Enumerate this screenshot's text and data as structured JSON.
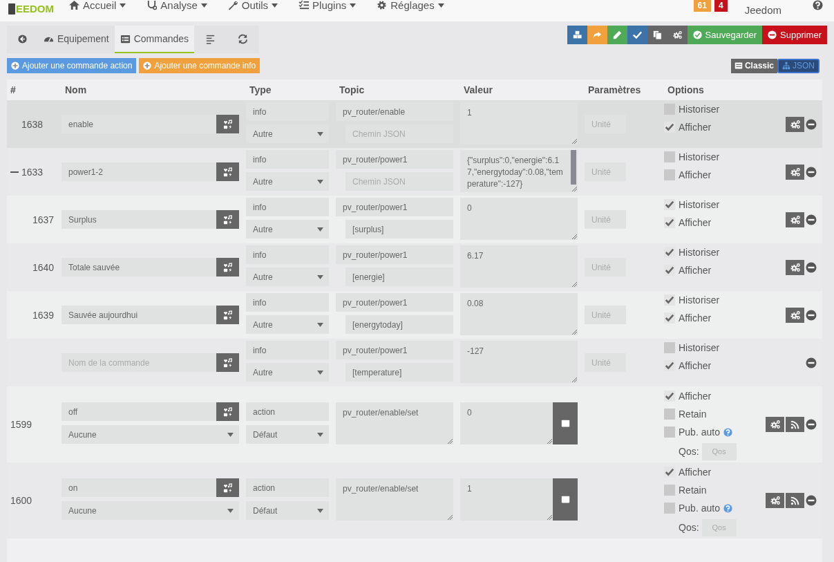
{
  "navbar": {
    "logo": "EEDOM",
    "menus": [
      {
        "kind": "home",
        "label": "Accueil"
      },
      {
        "kind": "analysis",
        "label": "Analyse"
      },
      {
        "kind": "tools",
        "label": "Outils"
      },
      {
        "kind": "plugins",
        "label": "Plugins"
      },
      {
        "kind": "settings",
        "label": "Réglages"
      }
    ],
    "badges": [
      {
        "text": "61",
        "color": "#f0a03c"
      },
      {
        "text": "4",
        "color": "#c8101a"
      }
    ],
    "user": "Jeedom"
  },
  "tabs": [
    {
      "kind": "back",
      "selected": false
    },
    {
      "kind": "equipment",
      "label": "Equipement",
      "selected": false
    },
    {
      "kind": "commands",
      "label": "Commandes",
      "selected": true
    },
    {
      "kind": "list",
      "selected": false
    },
    {
      "kind": "refresh",
      "selected": false
    }
  ],
  "toolbar": [
    {
      "kind": "cubes",
      "color": "#3c73a8"
    },
    {
      "kind": "share",
      "color": "#f0a03c"
    },
    {
      "kind": "pencil",
      "color": "#4faa58"
    },
    {
      "kind": "check",
      "color": "#3c73a8"
    },
    {
      "kind": "copy",
      "color": "#666666"
    },
    {
      "kind": "gears",
      "color": "#666666"
    },
    {
      "kind": "save",
      "label": "Sauvegarder",
      "color": "#4faa58"
    },
    {
      "kind": "delete",
      "label": "Supprimer",
      "color": "#c8101a"
    }
  ],
  "add_buttons": [
    {
      "label": "Ajouter une commande action",
      "color": "#5b9ae0"
    },
    {
      "label": "Ajouter une commande info",
      "color": "#f0a03c"
    }
  ],
  "view_toggle": [
    {
      "kind": "classic",
      "label": "Classic",
      "selected": false
    },
    {
      "kind": "json",
      "label": "JSON",
      "selected": true
    }
  ],
  "table": {
    "columns": [
      "#",
      "Nom",
      "Type",
      "Topic",
      "Valeur",
      "Paramètres",
      "Options"
    ],
    "rows": [
      {
        "kind": "info",
        "id": "1638",
        "highlighted": true,
        "name": "enable",
        "type": "info",
        "subtype": "Autre",
        "topic": "pv_router/enable",
        "json_path_placeholder": "Chemin JSON",
        "value": "1",
        "unit_placeholder": "Unité",
        "options": [
          {
            "label": "Historiser",
            "checked": false
          },
          {
            "label": "Afficher",
            "checked": true
          }
        ],
        "config_button": true
      },
      {
        "kind": "info",
        "id": "1633",
        "highlighted": false,
        "expanded": true,
        "name": "power1-2",
        "type": "info",
        "subtype": "Autre",
        "topic": "pv_router/power1",
        "json_path_placeholder": "Chemin JSON",
        "value": "{\"surplus\":0,\"energie\":6.17,\"energytoday\":0.08,\"temperature\":-127}",
        "unit_placeholder": "Unité",
        "options": [
          {
            "label": "Historiser",
            "checked": false
          },
          {
            "label": "Afficher",
            "checked": false
          }
        ],
        "config_button": true,
        "children": [
          {
            "kind": "info",
            "id": "1637",
            "highlighted": false,
            "name": "Surplus",
            "type": "info",
            "subtype": "Autre",
            "topic": "pv_router/power1",
            "json_path": "[surplus]",
            "value": "0",
            "unit_placeholder": "Unité",
            "options": [
              {
                "label": "Historiser",
                "checked": true
              },
              {
                "label": "Afficher",
                "checked": true
              }
            ],
            "config_button": true
          },
          {
            "kind": "info",
            "id": "1640",
            "highlighted": false,
            "name": "Totale sauvée",
            "type": "info",
            "subtype": "Autre",
            "topic": "pv_router/power1",
            "json_path": "[energie]",
            "value": "6.17",
            "unit_placeholder": "Unité",
            "options": [
              {
                "label": "Historiser",
                "checked": true
              },
              {
                "label": "Afficher",
                "checked": true
              }
            ],
            "config_button": true
          },
          {
            "kind": "info",
            "id": "1639",
            "highlighted": false,
            "name": "Sauvée aujourdhui",
            "type": "info",
            "subtype": "Autre",
            "topic": "pv_router/power1",
            "json_path": "[energytoday]",
            "value": "0.08",
            "unit_placeholder": "Unité",
            "options": [
              {
                "label": "Historiser",
                "checked": true
              },
              {
                "label": "Afficher",
                "checked": true
              }
            ],
            "config_button": true
          },
          {
            "kind": "info",
            "highlighted": false,
            "name_placeholder": "Nom de la commande",
            "type": "info",
            "subtype": "Autre",
            "topic": "pv_router/power1",
            "json_path": "[temperature]",
            "value": "-127",
            "unit_placeholder": "Unité",
            "options": [
              {
                "label": "Historiser",
                "checked": false
              },
              {
                "label": "Afficher",
                "checked": true
              }
            ],
            "config_button": false
          }
        ]
      },
      {
        "kind": "action",
        "id": "1599",
        "highlighted": false,
        "name": "off",
        "select": "Aucune",
        "type": "action",
        "subtype": "Défaut",
        "topic": "pv_router/enable/set",
        "value": "0",
        "options": [
          {
            "label": "Afficher",
            "checked": true
          },
          {
            "label": "Retain",
            "checked": false
          },
          {
            "label": "Pub. auto",
            "checked": false,
            "help": true
          }
        ],
        "qos_label": "Qos:",
        "qos_placeholder": "Qos",
        "config_button": true
      },
      {
        "kind": "action",
        "id": "1600",
        "highlighted": false,
        "name": "on",
        "select": "Aucune",
        "type": "action",
        "subtype": "Défaut",
        "topic": "pv_router/enable/set",
        "value": "1",
        "options": [
          {
            "label": "Afficher",
            "checked": true
          },
          {
            "label": "Retain",
            "checked": false
          },
          {
            "label": "Pub. auto",
            "checked": false,
            "help": true
          }
        ],
        "qos_label": "Qos:",
        "qos_placeholder": "Qos",
        "config_button": true
      }
    ]
  }
}
